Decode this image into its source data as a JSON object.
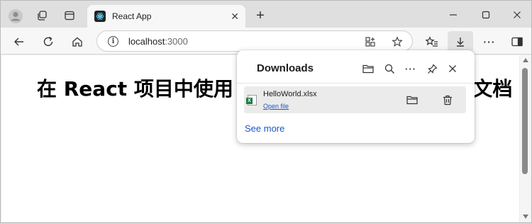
{
  "tab": {
    "title": "React App",
    "close": "✕"
  },
  "tabbar": {
    "new_tab": "+"
  },
  "window_controls": {
    "minimize": "—",
    "maximize": "☐",
    "close": "✕"
  },
  "address": {
    "host": "localhost",
    "port": ":3000"
  },
  "page": {
    "heading": "在 React 项目中使用 JavaScript 导出 Excel 文档"
  },
  "downloads": {
    "title": "Downloads",
    "items": [
      {
        "file_name": "HelloWorld.xlsx",
        "action": "Open file"
      }
    ],
    "see_more": "See more"
  },
  "colors": {
    "accent_link": "#1a56c9",
    "excel_green": "#1f7a46"
  }
}
